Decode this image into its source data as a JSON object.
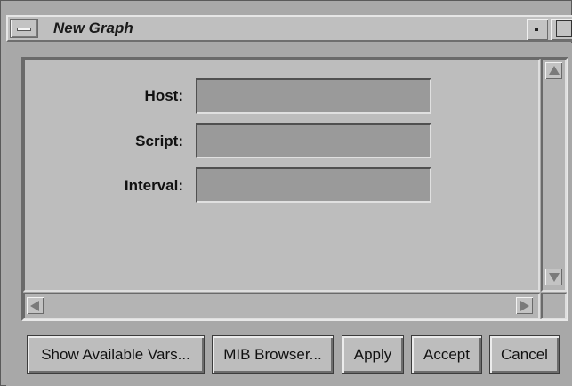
{
  "window": {
    "title": "New Graph"
  },
  "form": {
    "fields": [
      {
        "label": "Host:",
        "value": ""
      },
      {
        "label": "Script:",
        "value": ""
      },
      {
        "label": "Interval:",
        "value": ""
      }
    ]
  },
  "buttons": {
    "show_vars": "Show Available Vars...",
    "mib_browser": "MIB Browser...",
    "apply": "Apply",
    "accept": "Accept",
    "cancel": "Cancel"
  },
  "icons": {
    "window_menu": "window-menu-icon",
    "minimize": "minimize-icon",
    "maximize": "maximize-icon",
    "scroll_up": "arrow-up-icon",
    "scroll_down": "arrow-down-icon",
    "scroll_left": "arrow-left-icon",
    "scroll_right": "arrow-right-icon"
  },
  "colors": {
    "window_bg": "#a9a9a9",
    "panel_bg": "#bdbdbd",
    "input_bg": "#9a9a9a",
    "title_text": "#1a1a1a"
  }
}
